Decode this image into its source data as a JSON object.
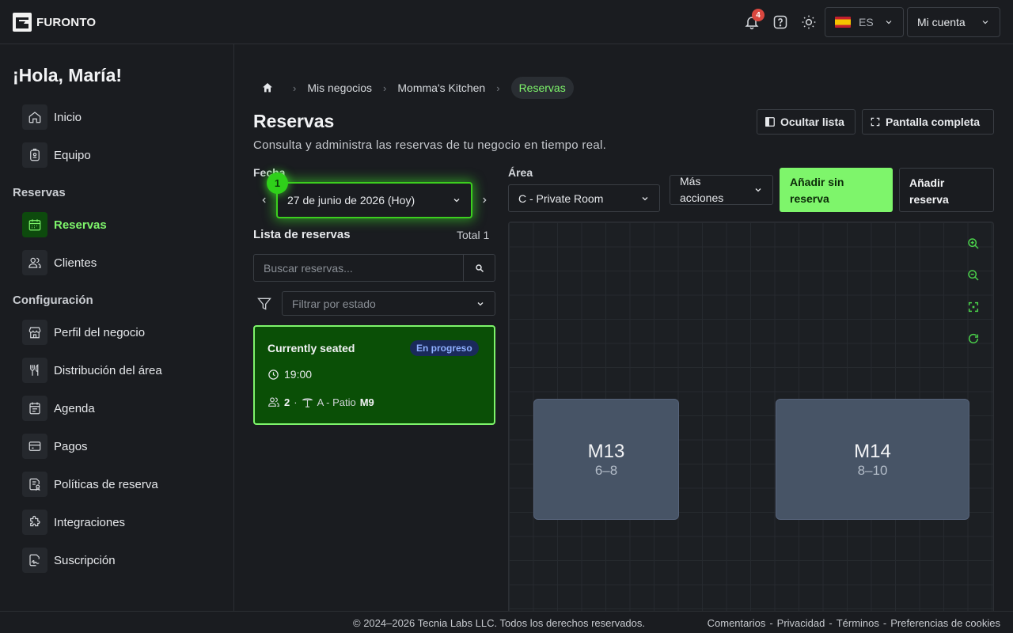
{
  "header": {
    "logo_text": "FURONTO",
    "notification_count": "4",
    "language": "ES",
    "account_label": "Mi cuenta"
  },
  "sidebar": {
    "greeting": "¡Hola, María!",
    "items_top": [
      {
        "label": "Inicio",
        "icon": "home-icon"
      },
      {
        "label": "Equipo",
        "icon": "badge-icon"
      }
    ],
    "section_reservas": "Reservas",
    "items_reservas": [
      {
        "label": "Reservas",
        "icon": "calendar-icon",
        "active": true
      },
      {
        "label": "Clientes",
        "icon": "users-icon"
      }
    ],
    "section_config": "Configuración",
    "items_config": [
      {
        "label": "Perfil del negocio",
        "icon": "store-icon"
      },
      {
        "label": "Distribución del área",
        "icon": "utensils-icon"
      },
      {
        "label": "Agenda",
        "icon": "agenda-icon"
      },
      {
        "label": "Pagos",
        "icon": "credit-card-icon"
      },
      {
        "label": "Políticas de reserva",
        "icon": "policy-icon"
      },
      {
        "label": "Integraciones",
        "icon": "puzzle-icon"
      },
      {
        "label": "Suscripción",
        "icon": "signature-icon"
      }
    ]
  },
  "breadcrumb": [
    "Mis negocios",
    "Momma's Kitchen",
    "Reservas"
  ],
  "page": {
    "title": "Reservas",
    "subtitle": "Consulta y administra las reservas de tu negocio en tiempo real.",
    "hide_list": "Ocultar lista",
    "fullscreen": "Pantalla completa"
  },
  "controls": {
    "date_label": "Fecha",
    "date_value": "27 de junio de 2026 (Hoy)",
    "step_number": "1",
    "area_label": "Área",
    "area_value": "C - Private Room",
    "more_actions_1": "Más",
    "more_actions_2": "acciones",
    "add_walkin_1": "Añadir sin",
    "add_walkin_2": "reserva",
    "add_res_1": "Añadir",
    "add_res_2": "reserva"
  },
  "list": {
    "title": "Lista de reservas",
    "total": "Total 1",
    "search_placeholder": "Buscar reservas...",
    "filter_placeholder": "Filtrar por estado",
    "reservations": [
      {
        "name": "Currently seated",
        "status": "En progreso",
        "time": "19:00",
        "guests": "2",
        "area": "A - Patio",
        "table": "M9"
      }
    ]
  },
  "floor": {
    "tables": [
      {
        "name": "M13",
        "capacity": "6–8"
      },
      {
        "name": "M14",
        "capacity": "8–10"
      }
    ]
  },
  "footer": {
    "copyright": "© 2024–2026 Tecnia Labs LLC. Todos los derechos reservados.",
    "links": [
      "Comentarios",
      "Privacidad",
      "Términos",
      "Preferencias de cookies"
    ]
  },
  "colors": {
    "accent": "#7ef56b",
    "card_bg": "#0a4f06",
    "badge_red": "#d9473f"
  }
}
